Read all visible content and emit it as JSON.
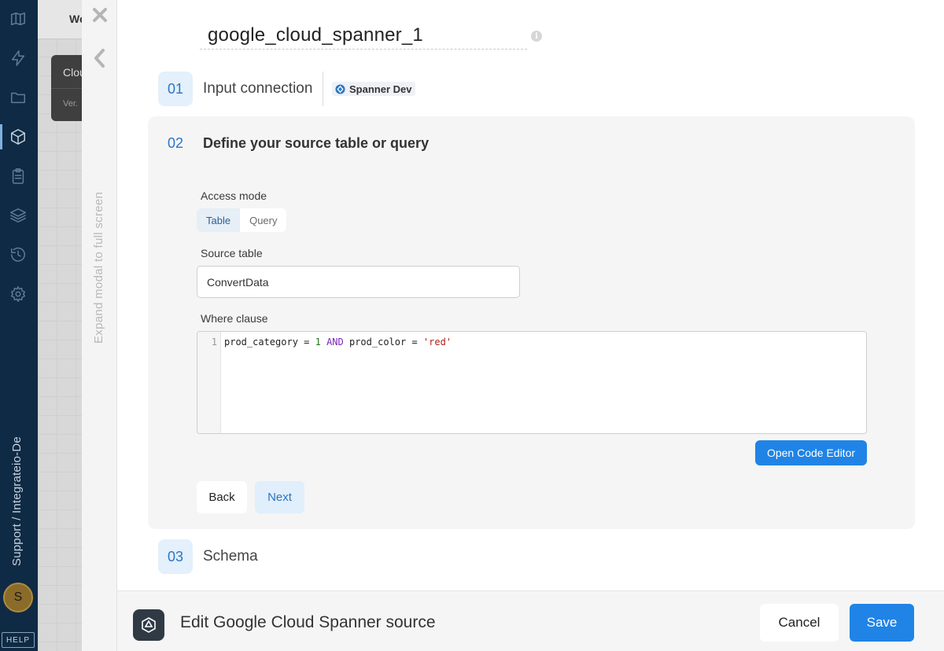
{
  "sidebar": {
    "icons": [
      "logo-icon",
      "lightning-icon",
      "folder-icon",
      "package-icon",
      "clipboard-icon",
      "layers-icon",
      "history-icon",
      "settings-icon"
    ],
    "breadcrumb": "Support / Integrateio-De",
    "avatar_initial": "S",
    "help_label": "HELP"
  },
  "background": {
    "header_text": "We",
    "card_title": "Clou",
    "card_subtitle": "Ver."
  },
  "modal": {
    "expand_label": "Expand modal to full screen",
    "title": "google_cloud_spanner_1",
    "info_icon": "i",
    "steps": [
      {
        "number": "01",
        "label": "Input connection"
      },
      {
        "number": "02",
        "label": "Define your source table or query"
      },
      {
        "number": "03",
        "label": "Schema"
      }
    ],
    "connection_name": "Spanner Dev",
    "access_mode": {
      "label": "Access mode",
      "options": [
        "Table",
        "Query"
      ],
      "selected": "Table"
    },
    "source_table": {
      "label": "Source table",
      "value": "ConvertData"
    },
    "where_clause": {
      "label": "Where clause",
      "line_number": "1",
      "tokens": {
        "t1": "prod_category = ",
        "t2": "1",
        "t3": " ",
        "t4": "AND",
        "t5": " prod_color = ",
        "t6": "'red'"
      }
    },
    "open_code_editor_label": "Open Code Editor",
    "back_label": "Back",
    "next_label": "Next",
    "footer": {
      "title": "Edit Google Cloud Spanner source",
      "cancel_label": "Cancel",
      "save_label": "Save"
    }
  },
  "colors": {
    "sidebar_bg": "#0f2a44",
    "accent": "#1f84e6",
    "step_badge_bg": "#e4f0fb"
  }
}
